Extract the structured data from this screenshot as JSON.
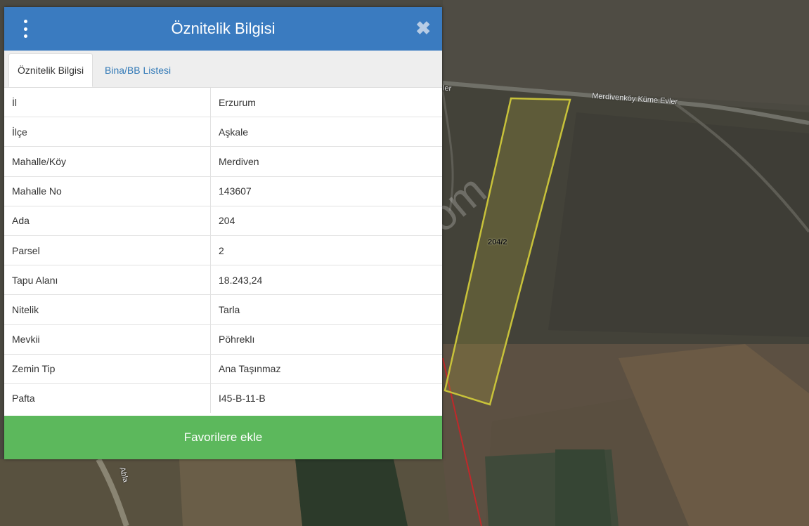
{
  "popup": {
    "title": "Öznitelik Bilgisi",
    "tabs": [
      {
        "label": "Öznitelik Bilgisi",
        "active": true
      },
      {
        "label": "Bina/BB Listesi",
        "active": false
      }
    ],
    "rows": [
      {
        "key": "İl",
        "value": "Erzurum"
      },
      {
        "key": "İlçe",
        "value": "Aşkale"
      },
      {
        "key": "Mahalle/Köy",
        "value": "Merdiven"
      },
      {
        "key": "Mahalle No",
        "value": "143607"
      },
      {
        "key": "Ada",
        "value": "204"
      },
      {
        "key": "Parsel",
        "value": "2"
      },
      {
        "key": "Tapu Alanı",
        "value": "18.243,24"
      },
      {
        "key": "Nitelik",
        "value": "Tarla"
      },
      {
        "key": "Mevkii",
        "value": "Pöhreklı"
      },
      {
        "key": "Zemin Tip",
        "value": "Ana Taşınmaz"
      },
      {
        "key": "Pafta",
        "value": "I45-B-11-B"
      }
    ],
    "favorite_button": "Favorilere ekle"
  },
  "map": {
    "road_label": "Merdivenköy Küme Evler",
    "road_label_left": "ler",
    "road_label_bottom": "Abla",
    "parcel_label": "204/2",
    "watermark": "emlakjet.com"
  },
  "colors": {
    "header": "#3a7bc0",
    "favorite_button": "#5cb85c",
    "parcel_outline": "#c8c23a"
  }
}
